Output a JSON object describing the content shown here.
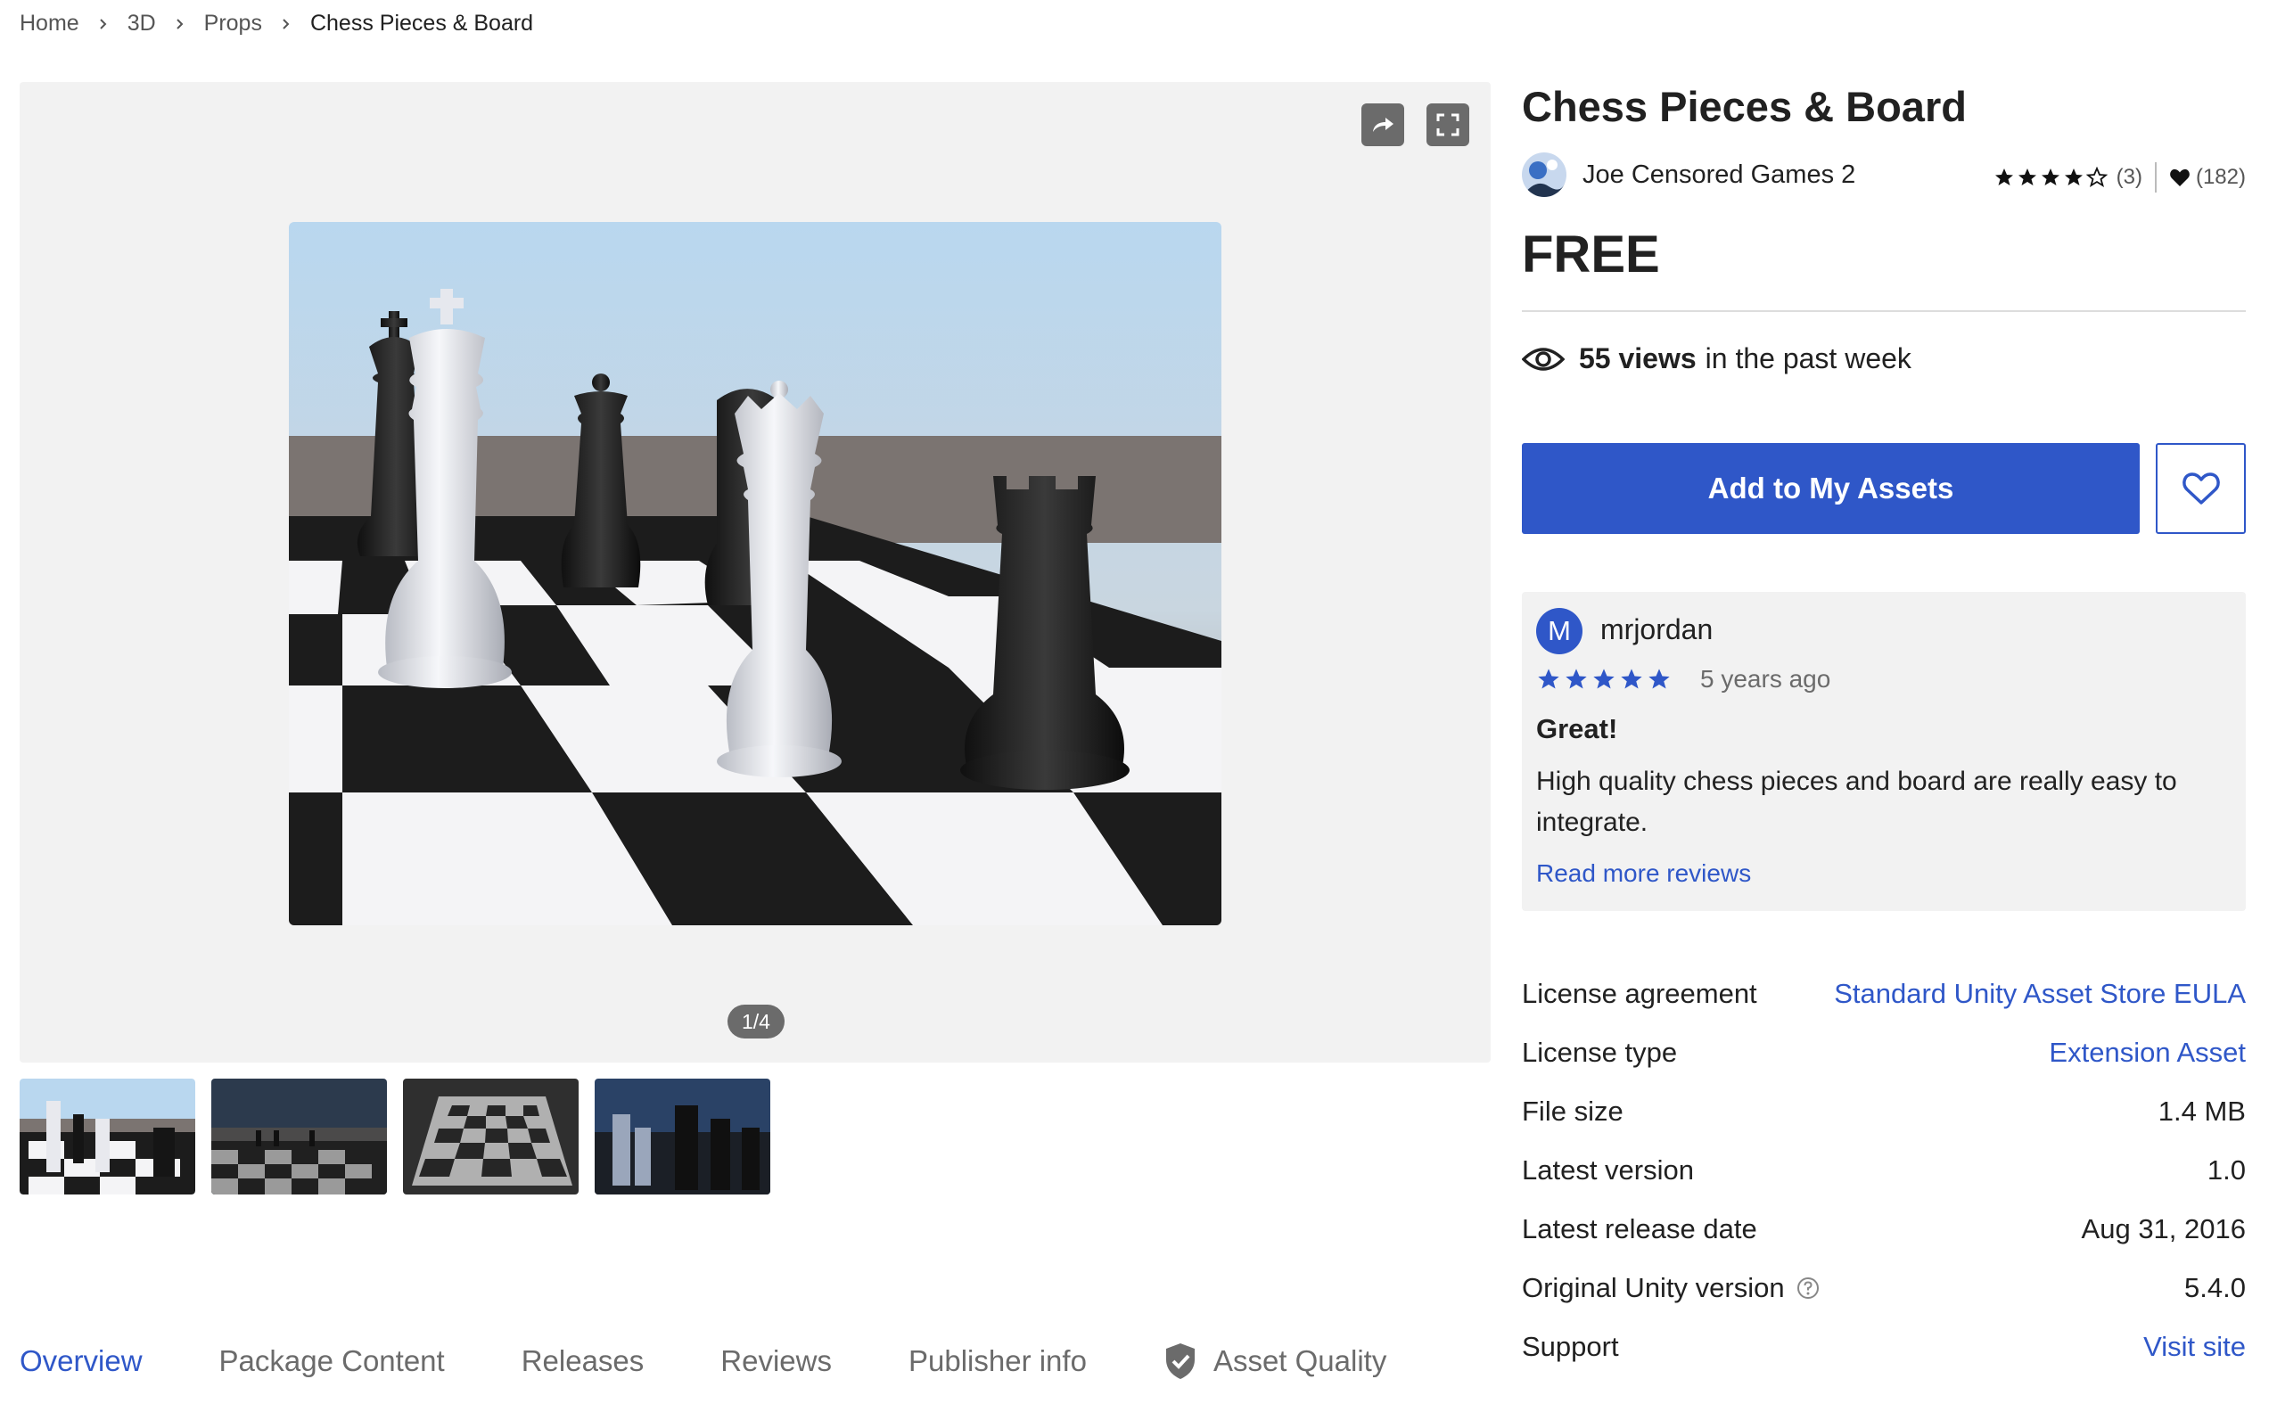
{
  "breadcrumb": {
    "items": [
      "Home",
      "3D",
      "Props"
    ],
    "current": "Chess Pieces & Board"
  },
  "gallery": {
    "pager": "1/4",
    "thumbnail_count": 4
  },
  "product": {
    "title": "Chess Pieces & Board",
    "publisher": "Joe Censored Games 2",
    "rating_stars": 4,
    "rating_count": "(3)",
    "favorites_count": "(182)",
    "price": "FREE",
    "views_bold": "55 views",
    "views_rest": "in the past week",
    "add_button": "Add to My Assets"
  },
  "review": {
    "avatar_letter": "M",
    "user": "mrjordan",
    "stars": 5,
    "date": "5 years ago",
    "title": "Great!",
    "body": "High quality chess pieces and board are really easy to integrate.",
    "link": "Read more reviews"
  },
  "details": [
    {
      "label": "License agreement",
      "value": "Standard Unity Asset Store EULA",
      "link": true
    },
    {
      "label": "License type",
      "value": "Extension Asset",
      "link": true
    },
    {
      "label": "File size",
      "value": "1.4 MB",
      "link": false
    },
    {
      "label": "Latest version",
      "value": "1.0",
      "link": false
    },
    {
      "label": "Latest release date",
      "value": "Aug 31, 2016",
      "link": false
    },
    {
      "label": "Original Unity version",
      "value": "5.4.0",
      "link": false,
      "help": true
    },
    {
      "label": "Support",
      "value": "Visit site",
      "link": true
    }
  ],
  "tabs": [
    "Overview",
    "Package Content",
    "Releases",
    "Reviews",
    "Publisher info",
    "Asset Quality"
  ],
  "colors": {
    "accent": "#2f57c8",
    "gallery_bg": "#f2f2f2",
    "text": "#212121",
    "muted": "#6b6b6b"
  },
  "icons": [
    "chevron-right-icon",
    "share-icon",
    "fullscreen-icon",
    "star-icon",
    "heart-icon",
    "eye-icon",
    "help-icon",
    "shield-check-icon"
  ]
}
